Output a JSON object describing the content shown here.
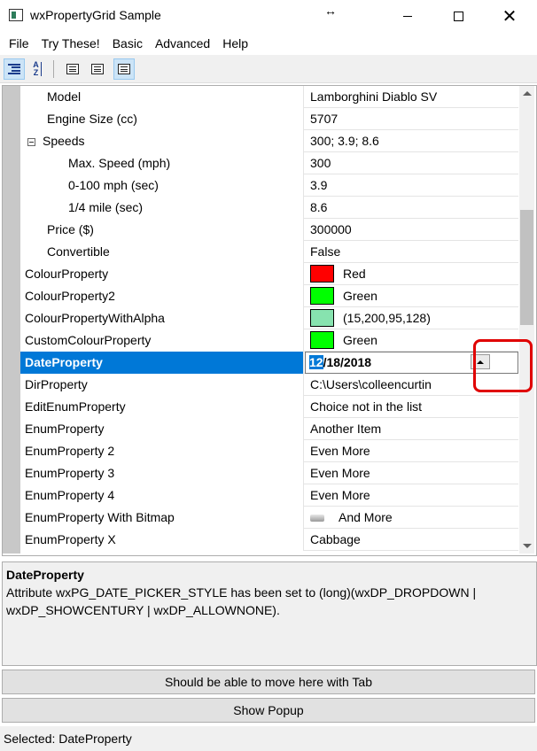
{
  "window": {
    "title": "wxPropertyGrid Sample",
    "resize_icon": "↔",
    "close_icon": "✕"
  },
  "menu": [
    "File",
    "Try These!",
    "Basic",
    "Advanced",
    "Help"
  ],
  "toolbar": {
    "az_label_top": "A",
    "az_label_bottom": "Z"
  },
  "grid": {
    "rows": [
      {
        "name": "Model",
        "value": "Lamborghini Diablo SV"
      },
      {
        "name": "Engine Size (cc)",
        "value": "5707"
      },
      {
        "name": "Speeds",
        "value": "300; 3.9; 8.6"
      },
      {
        "name": "Max. Speed (mph)",
        "value": "300"
      },
      {
        "name": "0-100 mph (sec)",
        "value": "3.9"
      },
      {
        "name": "1/4 mile (sec)",
        "value": "8.6"
      },
      {
        "name": "Price ($)",
        "value": "300000"
      },
      {
        "name": "Convertible",
        "value": "False"
      },
      {
        "name": "ColourProperty",
        "value": "Red",
        "color": "#ff0000"
      },
      {
        "name": "ColourProperty2",
        "value": "Green",
        "color": "#00ff00"
      },
      {
        "name": "ColourPropertyWithAlpha",
        "value": "(15,200,95,128)",
        "color": "#87e3af"
      },
      {
        "name": "CustomColourProperty",
        "value": "Green",
        "color": "#00ff00"
      },
      {
        "name": "DateProperty",
        "value_selected_part": "12",
        "value_rest": "/18/2018"
      },
      {
        "name": "DirProperty",
        "value": "C:\\Users\\colleencurtin"
      },
      {
        "name": "EditEnumProperty",
        "value": "Choice not in the list"
      },
      {
        "name": "EnumProperty",
        "value": "Another Item"
      },
      {
        "name": "EnumProperty 2",
        "value": "Even More"
      },
      {
        "name": "EnumProperty 3",
        "value": "Even More"
      },
      {
        "name": "EnumProperty 4",
        "value": "Even More"
      },
      {
        "name": "EnumProperty With Bitmap",
        "value": "And More"
      },
      {
        "name": "EnumProperty X",
        "value": "Cabbage"
      }
    ]
  },
  "description": {
    "title": "DateProperty",
    "text": "Attribute wxPG_DATE_PICKER_STYLE has been set to (long)(wxDP_DROPDOWN | wxDP_SHOWCENTURY | wxDP_ALLOWNONE)."
  },
  "buttons": {
    "tab_label": "Should be able to move here with Tab",
    "popup_label": "Show Popup"
  },
  "status": {
    "text": "Selected: DateProperty"
  }
}
